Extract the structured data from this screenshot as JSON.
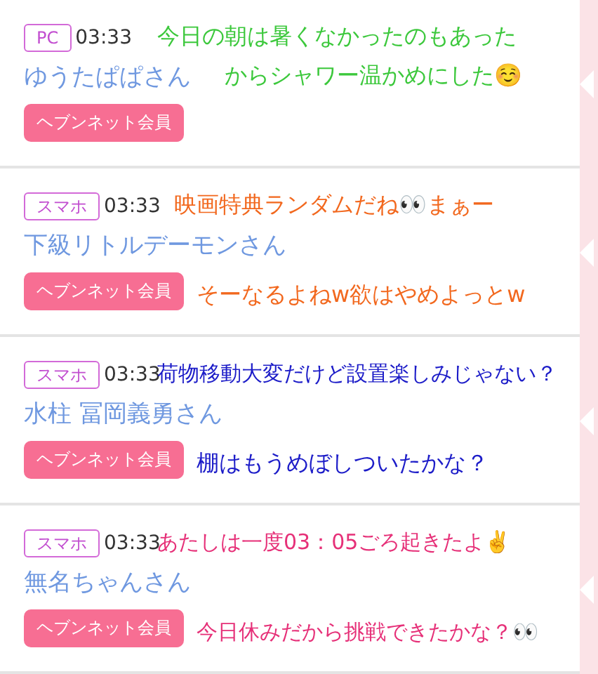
{
  "posts": [
    {
      "device": "PC",
      "time": "03:33",
      "name": "ゆうたぱぱさん",
      "badge": "ヘブンネット会員",
      "captions": [
        {
          "text": "今日の朝は暑くなかったのもあった",
          "color": "#3cc83c"
        },
        {
          "text": "からシャワー温かめにした☺️",
          "color": "#3cc83c"
        }
      ]
    },
    {
      "device": "スマホ",
      "time": "03:33",
      "name": "下級リトルデーモンさん",
      "badge": "ヘブンネット会員",
      "captions": [
        {
          "text": "映画特典ランダムだね👀まぁー",
          "color": "#f2681e"
        },
        {
          "text": "そーなるよねw欲はやめよっとw",
          "color": "#f2681e"
        }
      ]
    },
    {
      "device": "スマホ",
      "time": "03:33",
      "name": "水柱 冨岡義勇さん",
      "badge": "ヘブンネット会員",
      "captions": [
        {
          "text": "荷物移動大変だけど設置楽しみじゃない？",
          "color": "#1c1cc8"
        },
        {
          "text": "棚はもうめぼしついたかな？",
          "color": "#1c1cc8"
        }
      ]
    },
    {
      "device": "スマホ",
      "time": "03:33",
      "name": "無名ちゃんさん",
      "badge": "ヘブンネット会員",
      "captions": [
        {
          "text": "あたしは一度03：05ごろ起きたよ✌️",
          "color": "#e63078"
        },
        {
          "text": "今日休みだから挑戦できたかな？👀",
          "color": "#e63078"
        }
      ]
    }
  ]
}
